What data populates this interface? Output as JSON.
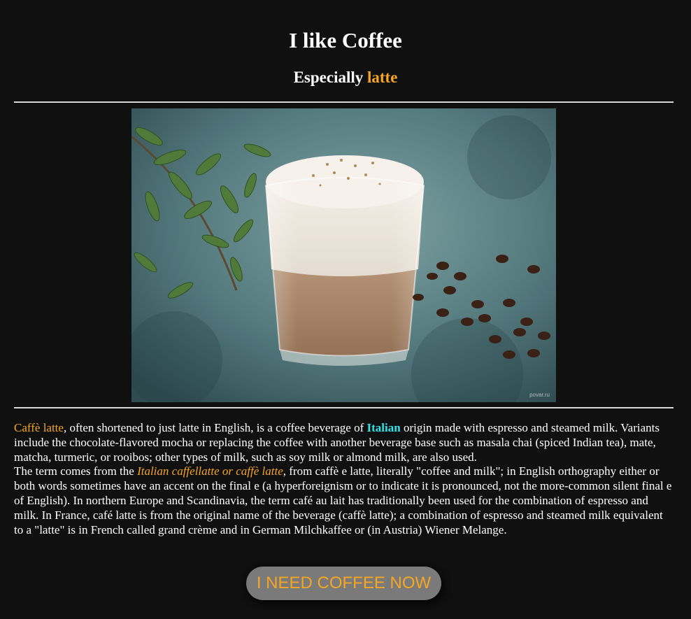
{
  "header": {
    "title": "I like Coffee",
    "subtitle_prefix": "Especially ",
    "subtitle_highlight": "latte"
  },
  "image": {
    "alt": "Glass of caffe latte with coffee beans and green leaves",
    "watermark": "povar.ru"
  },
  "article": {
    "p1_term": "Caffè latte",
    "p1_a": ", often shortened to just latte in English, is a coffee beverage of ",
    "p1_origin": "Italian",
    "p1_b": " origin made with espresso and steamed milk. Variants include the chocolate-flavored mocha or replacing the coffee with another beverage base such as masala chai (spiced Indian tea), mate, matcha, turmeric, or rooibos; other types of milk, such as soy milk or almond milk, are also used.",
    "p2_a": "The term comes from the ",
    "p2_italic": "Italian caffellatte or caffè latte",
    "p2_b": ", from caffè e latte, literally \"coffee and milk\"; in English orthography either or both words sometimes have an accent on the final e (a hyperforeignism or to indicate it is pronounced, not the more-common silent final e of English). In northern Europe and Scandinavia, the term café au lait has traditionally been used for the combination of espresso and milk. In France, café latte is from the original name of the beverage (caffè latte); a combination of espresso and steamed milk equivalent to a \"latte\" is in French called grand crème and in German Milchkaffee or (in Austria) Wiener Melange."
  },
  "cta": {
    "label": "I NEED COFFEE NOW"
  },
  "colors": {
    "background": "#101010",
    "text": "#ffffff",
    "accent": "#f5a623",
    "italian": "#2ee6ea",
    "button_bg": "#7a7a7a"
  }
}
